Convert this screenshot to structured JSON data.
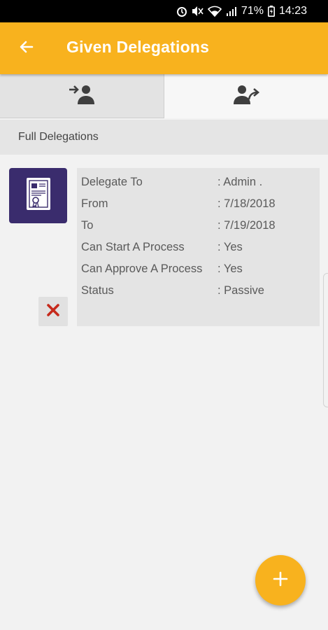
{
  "status_bar": {
    "battery": "71%",
    "time": "14:23",
    "icons": [
      "alarm-icon",
      "mute-icon",
      "wifi-icon",
      "signal-icon",
      "battery-icon"
    ]
  },
  "app_bar": {
    "title": "Given Delegations",
    "back_icon": "arrow-left-icon",
    "color": "#f8b21e"
  },
  "tabs": [
    {
      "icon": "incoming-user-icon",
      "selected": false
    },
    {
      "icon": "outgoing-user-icon",
      "selected": true
    }
  ],
  "section": {
    "title": "Full Delegations"
  },
  "delegation": {
    "thumb_icon": "certificate-document-icon",
    "thumb_color": "#3a2c6d",
    "delete_icon": "close-x-icon",
    "rows": [
      {
        "label": "Delegate To",
        "value": ": Admin ."
      },
      {
        "label": "From",
        "value": ": 7/18/2018"
      },
      {
        "label": "To",
        "value": ": 7/19/2018"
      },
      {
        "label": "Can Start A Process",
        "value": ": Yes"
      },
      {
        "label": "Can Approve A Process",
        "value": ": Yes"
      },
      {
        "label": "Status",
        "value": ": Passive"
      }
    ]
  },
  "fab": {
    "label": "+",
    "icon": "plus-icon"
  }
}
